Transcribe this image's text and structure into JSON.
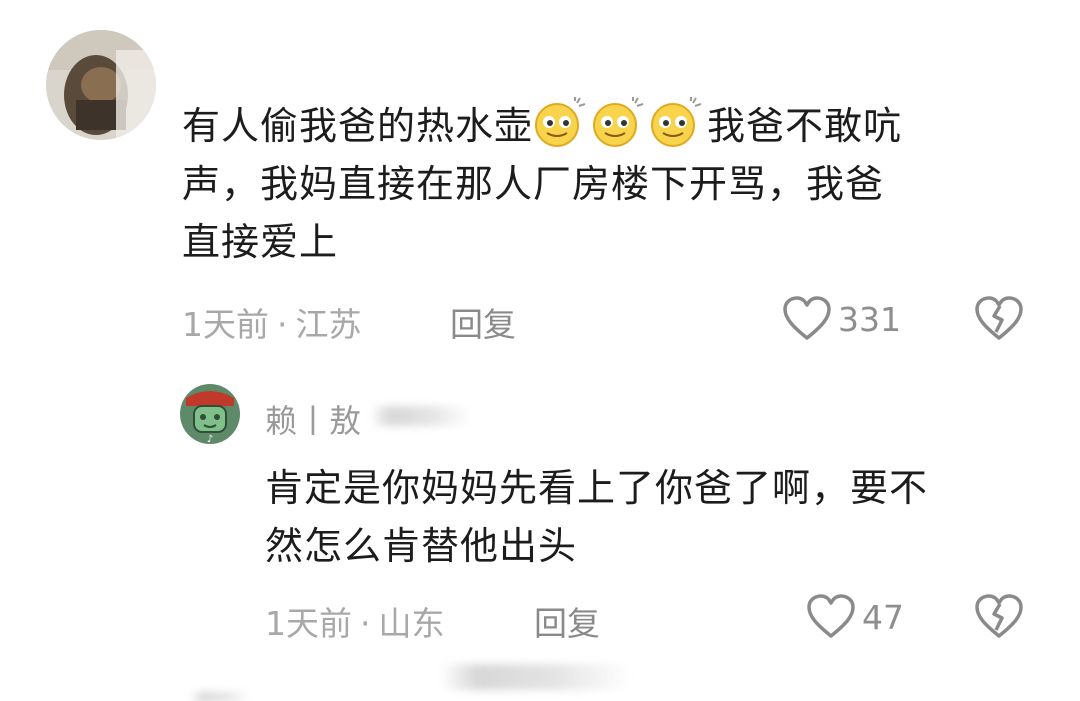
{
  "comment": {
    "text_lines": [
      {
        "before": "有人偷我爸的热水壶",
        "emoji": [
          "smirk-sweat-emoji",
          "smirk-sweat-emoji",
          "smirk-sweat-emoji"
        ],
        "after": "我爸不敢吭"
      },
      {
        "text": "声，我妈直接在那人厂房楼下开骂，我爸"
      },
      {
        "text": "直接爱上"
      }
    ],
    "time": "1天前",
    "separator": "·",
    "location": "江苏",
    "reply_label": "回复",
    "like_count": "331"
  },
  "reply": {
    "username": "赖丨敖",
    "text_lines": [
      "肯定是你妈妈先看上了你爸了啊，要不",
      "然怎么肯替他出头"
    ],
    "time": "1天前",
    "separator": "·",
    "location": "山东",
    "reply_label": "回复",
    "like_count": "47"
  },
  "colors": {
    "text": "#1c1c1c",
    "meta": "#a8a8a8",
    "icon": "#8a8a8a"
  }
}
